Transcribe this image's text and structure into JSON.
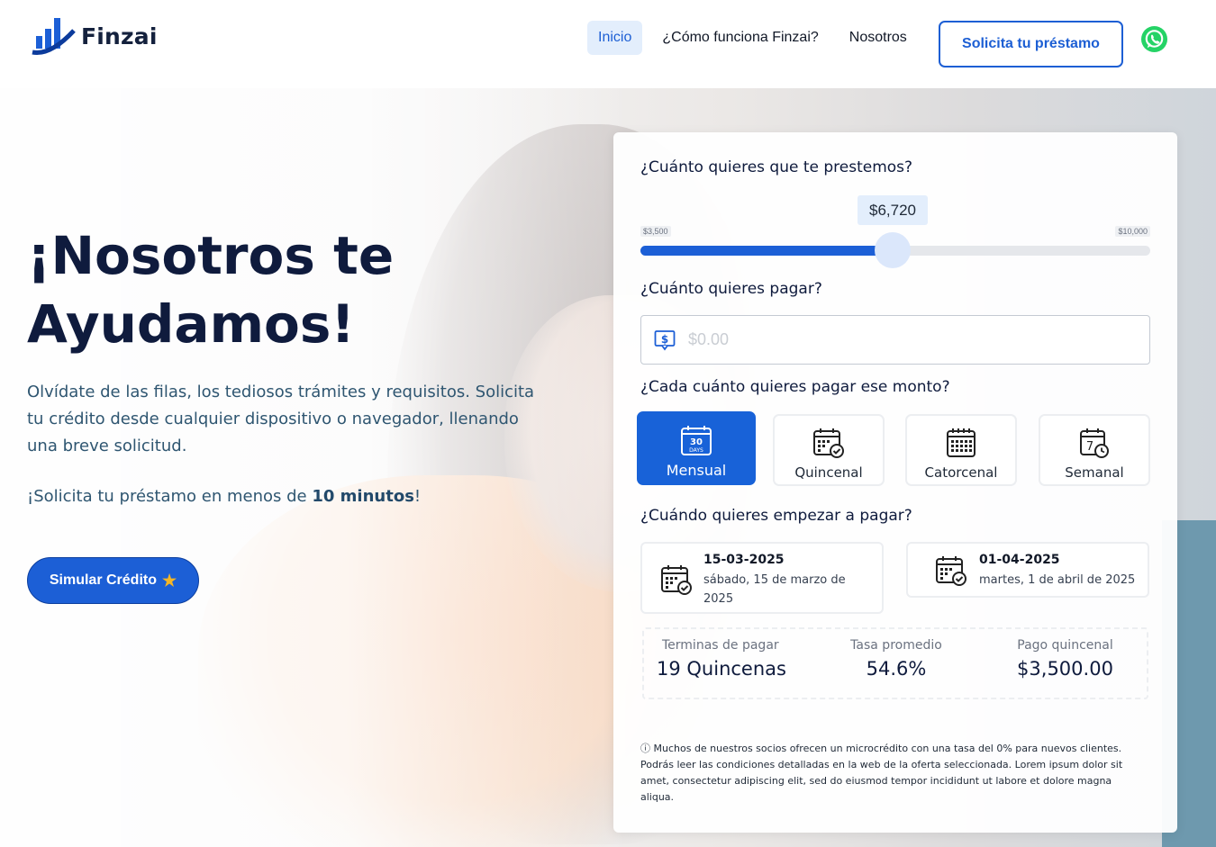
{
  "brand": {
    "name": "Finzai"
  },
  "nav": {
    "items": [
      {
        "label": "Inicio",
        "active": true
      },
      {
        "label": "¿Cómo funciona Finzai?",
        "active": false
      },
      {
        "label": "Nosotros",
        "active": false
      }
    ],
    "cta_label": "Solicita tu préstamo",
    "whatsapp_icon": "whatsapp-icon"
  },
  "hero": {
    "title": "¡Nosotros te Ayudamos!",
    "text": "Olvídate de las filas, los tediosos trámites y requisitos. Solicita tu crédito desde cualquier dispositivo o navegador, llenando una breve solicitud.",
    "sub_prefix": "¡Solicita tu préstamo en menos de ",
    "sub_bold": "10 minutos",
    "sub_suffix": "!",
    "button_label": "Simular Crédito",
    "button_icon": "star-icon"
  },
  "calculator": {
    "amount_question": "¿Cuánto quieres que te prestemos?",
    "slider": {
      "value_label": "$6,720",
      "min_label": "$3,500",
      "max_label": "$10,000",
      "value": 6720,
      "min": 3500,
      "max": 10000
    },
    "pay_question": "¿Cuánto quieres pagar?",
    "pay_placeholder": "$0.00",
    "pay_value": "",
    "frequency_question": "¿Cada cuánto quieres pagar ese monto?",
    "frequencies": [
      {
        "label": "Mensual",
        "icon": "calendar-30-days-icon",
        "selected": true
      },
      {
        "label": "Quincenal",
        "icon": "calendar-check-icon",
        "selected": false
      },
      {
        "label": "Catorcenal",
        "icon": "calendar-grid-icon",
        "selected": false
      },
      {
        "label": "Semanal",
        "icon": "calendar-7-clock-icon",
        "selected": false
      }
    ],
    "start_question": "¿Cuándo quieres empezar a pagar?",
    "dates": [
      {
        "date": "15-03-2025",
        "long": "sábado, 15 de marzo de 2025"
      },
      {
        "date": "01-04-2025",
        "long": "martes, 1 de abril de 2025"
      }
    ],
    "summary": [
      {
        "label": "Terminas de pagar",
        "value": "19 Quincenas"
      },
      {
        "label": "Tasa promedio",
        "value": "54.6%"
      },
      {
        "label": "Pago quincenal",
        "value": "$3,500.00"
      }
    ],
    "disclaimer": "Muchos de nuestros socios ofrecen un microcrédito con una tasa del 0% para nuevos clientes. Podrás leer las condiciones detalladas en la web de la oferta seleccionada. Lorem ipsum dolor sit amet, consectetur adipiscing elit, sed do eiusmod tempor incididunt ut labore et dolore magna aliqua.",
    "disclaimer_icon": "info-icon"
  },
  "colors": {
    "primary": "#1c5fd6",
    "nav_active_bg": "#e3eefc",
    "dark_text": "#0f1b3d",
    "hero_text": "#2f5671"
  }
}
